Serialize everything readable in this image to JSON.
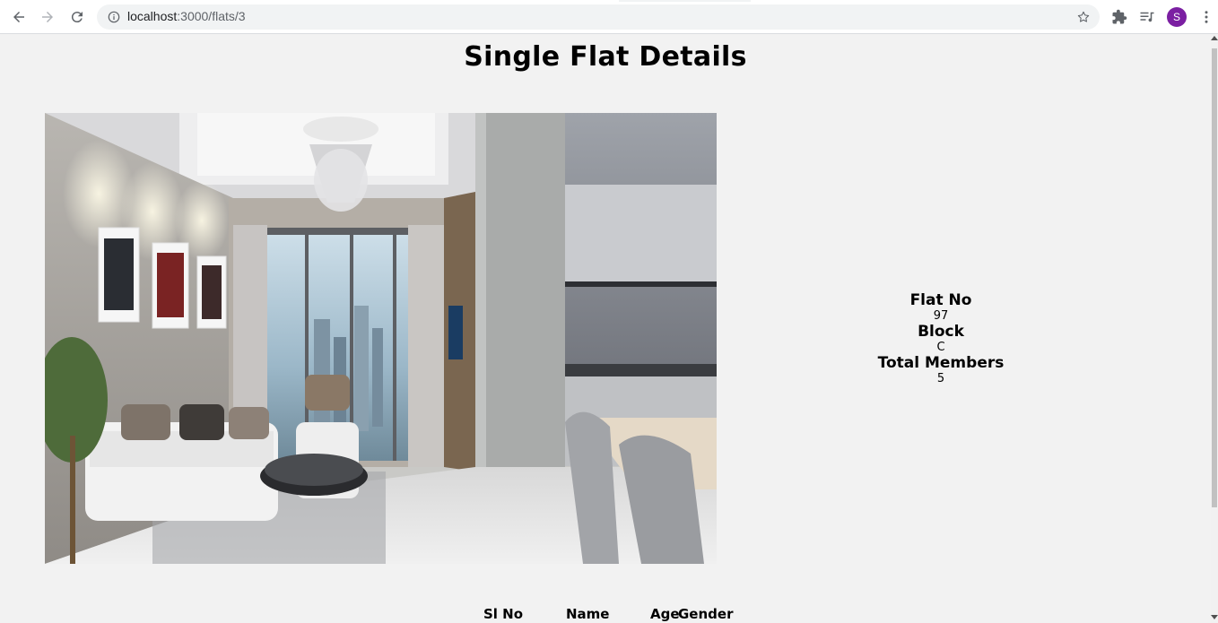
{
  "browser": {
    "url_host": "localhost",
    "url_path": ":3000/flats/3",
    "avatar_letter": "S",
    "avatar_color": "#7b1fa2",
    "icons": [
      "back-icon",
      "forward-icon",
      "reload-icon",
      "info-icon",
      "star-icon",
      "extensions-icon",
      "media-control-icon",
      "menu-kebab-icon"
    ]
  },
  "page": {
    "title": "Single Flat Details",
    "image_alt": "living room interior with kitchen",
    "details": {
      "flat_no_label": "Flat No",
      "flat_no_value": "97",
      "block_label": "Block",
      "block_value": "C",
      "members_label": "Total Members",
      "members_value": "5"
    },
    "members_table": {
      "headers": [
        "Sl No",
        "Name",
        "Age",
        "Gender"
      ]
    }
  }
}
